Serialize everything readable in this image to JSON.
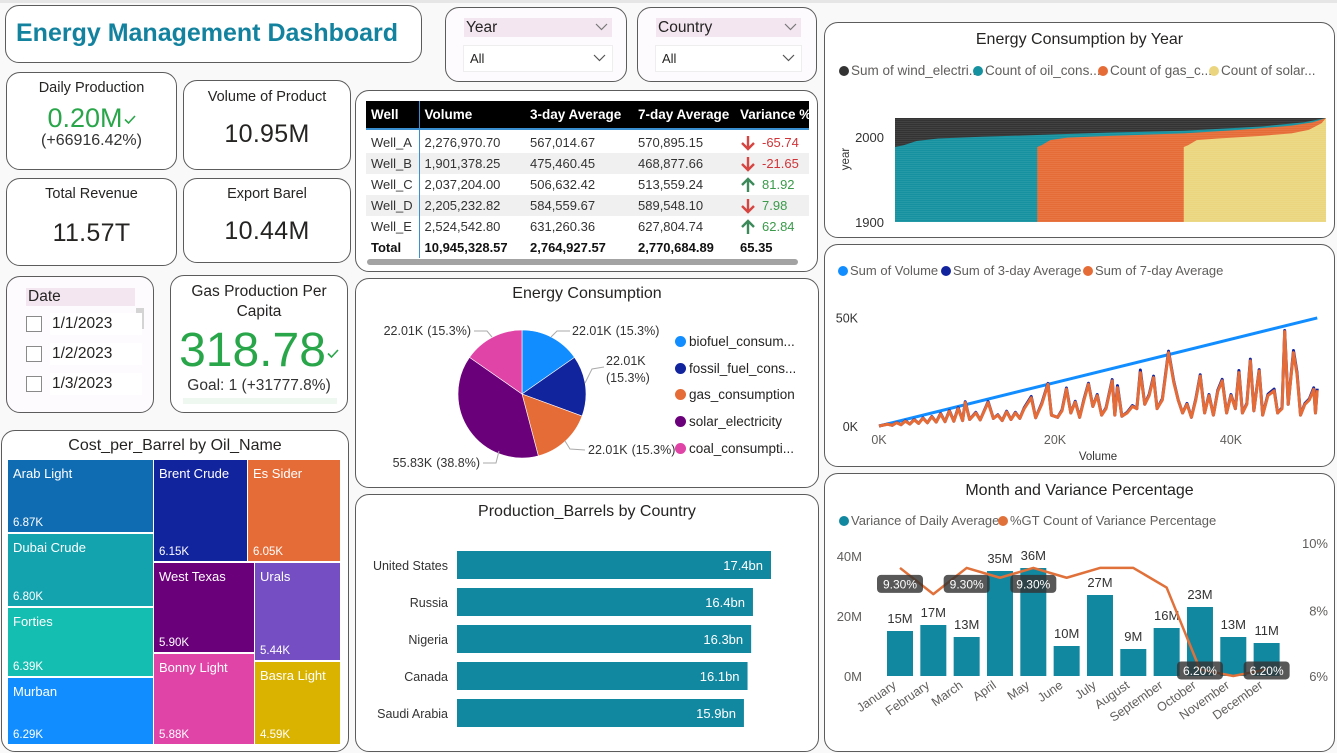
{
  "header": {
    "title": "Energy Management Dashboard"
  },
  "slicers": {
    "year": {
      "label": "Year",
      "value": "All"
    },
    "country": {
      "label": "Country",
      "value": "All"
    },
    "date": {
      "label": "Date",
      "options": [
        "1/1/2023",
        "1/2/2023",
        "1/3/2023"
      ]
    }
  },
  "cards": {
    "daily_production": {
      "title": "Daily Production",
      "value": "0.20M",
      "delta": "(+66916.42%)",
      "status": "good"
    },
    "volume_of_product": {
      "title": "Volume of Product",
      "value": "10.95M"
    },
    "total_revenue": {
      "title": "Total Revenue",
      "value": "11.57T"
    },
    "export_barel": {
      "title": "Export Barel",
      "value": "10.44M"
    },
    "gas_per_capita": {
      "title_line1": "Gas Production Per",
      "title_line2": "Capita",
      "value": "318.78",
      "goal": "Goal: 1 (+31777.8%)",
      "status": "good"
    }
  },
  "table": {
    "columns": [
      "Well",
      "Volume",
      "3-day Average",
      "7-day Average",
      "Variance %"
    ],
    "rows": [
      {
        "well": "Well_A",
        "volume": "2,276,970.70",
        "avg3": "567,014.67",
        "avg7": "570,895.15",
        "trend": "down",
        "variance": "-65.74",
        "variance_color": "#D13438"
      },
      {
        "well": "Well_B",
        "volume": "1,901,378.25",
        "avg3": "475,460.45",
        "avg7": "468,877.66",
        "trend": "down",
        "variance": "-21.65",
        "variance_color": "#D13438"
      },
      {
        "well": "Well_C",
        "volume": "2,037,204.00",
        "avg3": "506,632.42",
        "avg7": "513,559.24",
        "trend": "up",
        "variance": "81.92",
        "variance_color": "#3A9A4A"
      },
      {
        "well": "Well_D",
        "volume": "2,205,232.82",
        "avg3": "584,559.67",
        "avg7": "589,548.10",
        "trend": "down",
        "variance": "7.98",
        "variance_color": "#3A9A4A"
      },
      {
        "well": "Well_E",
        "volume": "2,524,542.80",
        "avg3": "631,260.36",
        "avg7": "627,804.74",
        "trend": "up",
        "variance": "62.84",
        "variance_color": "#3A9A4A"
      }
    ],
    "total": {
      "well": "Total",
      "volume": "10,945,328.57",
      "avg3": "2,764,927.57",
      "avg7": "2,770,684.89",
      "variance": "65.35"
    }
  },
  "colors": {
    "title": "#13829F",
    "good": "#2AA64A",
    "arrow_down": "#D64541",
    "arrow_up": "#3C8A5A",
    "accent_line": "#3A8FD0"
  },
  "chart_data": [
    {
      "type": "treemap",
      "title": "Cost_per_Barrel by Oil_Name",
      "items": [
        {
          "name": "Arab Light",
          "value": 6.87,
          "label": "6.87K",
          "color": "#0F6CB3"
        },
        {
          "name": "Dubai Crude",
          "value": 6.8,
          "label": "6.80K",
          "color": "#12A3AF"
        },
        {
          "name": "Forties",
          "value": 6.39,
          "label": "6.39K",
          "color": "#14BEB0"
        },
        {
          "name": "Murban",
          "value": 6.29,
          "label": "6.29K",
          "color": "#118DFF"
        },
        {
          "name": "Brent Crude",
          "value": 6.15,
          "label": "6.15K",
          "color": "#12239E"
        },
        {
          "name": "Es Sider",
          "value": 6.05,
          "label": "6.05K",
          "color": "#E66C37"
        },
        {
          "name": "West Texas",
          "value": 5.9,
          "label": "5.90K",
          "color": "#6B007B"
        },
        {
          "name": "Urals",
          "value": 5.44,
          "label": "5.44K",
          "color": "#744EC2"
        },
        {
          "name": "Bonny Light",
          "value": 5.88,
          "label": "5.88K",
          "color": "#E044A7"
        },
        {
          "name": "Basra Light",
          "value": 4.59,
          "label": "4.59K",
          "color": "#D9B300"
        }
      ]
    },
    {
      "type": "pie",
      "title": "Energy Consumption",
      "slices": [
        {
          "name": "biofuel_consum...",
          "value": 22.01,
          "value_label": "22.01K",
          "pct_label": "(15.3%)",
          "color": "#118DFF"
        },
        {
          "name": "fossil_fuel_cons...",
          "value": 22.01,
          "value_label": "22.01K",
          "pct_label": "(15.3%)",
          "color": "#12239E"
        },
        {
          "name": "gas_consumption",
          "value": 22.01,
          "value_label": "22.01K",
          "pct_label": "(15.3%)",
          "color": "#E66C37"
        },
        {
          "name": "solar_electricity",
          "value": 55.83,
          "value_label": "55.83K",
          "pct_label": "(38.8%)",
          "color": "#6B007B"
        },
        {
          "name": "coal_consumpti...",
          "value": 22.01,
          "value_label": "22.01K",
          "pct_label": "(15.3%)",
          "color": "#E044A7"
        }
      ]
    },
    {
      "type": "bar",
      "orientation": "horizontal",
      "title": "Production_Barrels by Country",
      "categories": [
        "United States",
        "Russia",
        "Nigeria",
        "Canada",
        "Saudi Arabia"
      ],
      "values": [
        17.4,
        16.4,
        16.3,
        16.1,
        15.9
      ],
      "labels": [
        "17.4bn",
        "16.4bn",
        "16.3bn",
        "16.1bn",
        "15.9bn"
      ],
      "unit": "bn",
      "color": "#1287A0",
      "xlim": [
        0,
        17.4
      ]
    },
    {
      "type": "area",
      "title": "Energy Consumption by Year",
      "ylabel": "year",
      "yticks": [
        2000,
        1900
      ],
      "ylim": [
        1900,
        2022
      ],
      "xlim": [
        0,
        100
      ],
      "legend": [
        {
          "name": "Sum of wind_electri...",
          "color": "#333333"
        },
        {
          "name": "Count of oil_cons...",
          "color": "#15919F"
        },
        {
          "name": "Count of gas_c...",
          "color": "#E66C37"
        },
        {
          "name": "Count of solar...",
          "color": "#EBD67F"
        }
      ],
      "layers": [
        {
          "series": "wind",
          "color": "#333333",
          "top": [
            [
              0,
              2022
            ],
            [
              100,
              2022
            ]
          ]
        },
        {
          "series": "oil",
          "color": "#15919F",
          "top": [
            [
              0,
              1988
            ],
            [
              2,
              1990
            ],
            [
              5,
              1995
            ],
            [
              10,
              1998
            ],
            [
              20,
              2000
            ],
            [
              33,
              2002
            ],
            [
              50,
              2005
            ],
            [
              67,
              2007
            ],
            [
              85,
              2012
            ],
            [
              95,
              2017
            ],
            [
              100,
              2022
            ]
          ]
        },
        {
          "series": "gas",
          "color": "#E66C37",
          "top": [
            [
              33,
              1988
            ],
            [
              34,
              1990
            ],
            [
              36,
              1996
            ],
            [
              40,
              1999
            ],
            [
              50,
              2001
            ],
            [
              67,
              2004
            ],
            [
              80,
              2008
            ],
            [
              92,
              2013
            ],
            [
              97,
              2017
            ],
            [
              100,
              2022
            ]
          ]
        },
        {
          "series": "solar",
          "color": "#EBD67F",
          "top": [
            [
              67,
              1988
            ],
            [
              68,
              1990
            ],
            [
              70,
              1996
            ],
            [
              75,
              1998
            ],
            [
              85,
              2001
            ],
            [
              92,
              2004
            ],
            [
              96,
              2008
            ],
            [
              99,
              2016
            ],
            [
              100,
              2022
            ]
          ]
        }
      ]
    },
    {
      "type": "line",
      "title": "",
      "xlabel": "Volume",
      "xticks": [
        {
          "value": 0,
          "label": "0K"
        },
        {
          "value": 20,
          "label": "20K"
        },
        {
          "value": 40,
          "label": "40K"
        }
      ],
      "yticks": [
        {
          "value": 50,
          "label": "50K"
        },
        {
          "value": 0,
          "label": "0K"
        }
      ],
      "xlim": [
        0,
        50
      ],
      "ylim": [
        0,
        50
      ],
      "units": "K",
      "legend": [
        {
          "name": "Sum of Volume",
          "color": "#118DFF"
        },
        {
          "name": "Sum of 3-day Average",
          "color": "#12239E"
        },
        {
          "name": "Sum of 7-day Average",
          "color": "#E66C37"
        }
      ],
      "volume_series": [
        [
          0,
          0
        ],
        [
          49.8,
          49.8
        ]
      ],
      "avg_points_x_y3_y7": [
        [
          0,
          0,
          0
        ],
        [
          1,
          0.9,
          0.8
        ],
        [
          1.5,
          0.3,
          0.3
        ],
        [
          2,
          1.6,
          1.5
        ],
        [
          2.5,
          0.6,
          0.6
        ],
        [
          3,
          2.4,
          2.2
        ],
        [
          3.5,
          0.9,
          0.9
        ],
        [
          4,
          3.0,
          2.8
        ],
        [
          4.5,
          1.2,
          1.2
        ],
        [
          5,
          3.7,
          3.5
        ],
        [
          5.5,
          1.5,
          1.5
        ],
        [
          6,
          4.4,
          4.2
        ],
        [
          6.5,
          1.8,
          1.8
        ],
        [
          7,
          5.8,
          5.5
        ],
        [
          7.5,
          2.0,
          2.0
        ],
        [
          8,
          7.1,
          6.8
        ],
        [
          8.5,
          2.2,
          2.2
        ],
        [
          9,
          8.4,
          8.0
        ],
        [
          9.5,
          2.5,
          2.5
        ],
        [
          9.8,
          11.2,
          10.8
        ],
        [
          10.3,
          3.0,
          3.0
        ],
        [
          11,
          6.3,
          6.0
        ],
        [
          11.5,
          2.8,
          2.8
        ],
        [
          12.4,
          11.2,
          10.8
        ],
        [
          13,
          3.5,
          3.5
        ],
        [
          13.5,
          5.2,
          5.0
        ],
        [
          14,
          2.5,
          2.5
        ],
        [
          14.5,
          6.8,
          6.5
        ],
        [
          15,
          3.0,
          3.0
        ],
        [
          15.5,
          6.3,
          6.0
        ],
        [
          16,
          3.5,
          3.5
        ],
        [
          16.5,
          8.4,
          8.0
        ],
        [
          17.3,
          13.6,
          13.0
        ],
        [
          17.8,
          3.8,
          3.8
        ],
        [
          18.5,
          10.5,
          10.0
        ],
        [
          19.2,
          19.6,
          19.2
        ],
        [
          19.6,
          5.0,
          5.0
        ],
        [
          20.3,
          4.0,
          4.0
        ],
        [
          20.8,
          7.4,
          7.0
        ],
        [
          21.3,
          17.5,
          17.0
        ],
        [
          21.8,
          6.0,
          6.0
        ],
        [
          22.3,
          11.4,
          11.0
        ],
        [
          22.8,
          4.0,
          4.0
        ],
        [
          23.3,
          12.5,
          12.0
        ],
        [
          23.8,
          19.7,
          19.2
        ],
        [
          24.3,
          9.0,
          9.0
        ],
        [
          24.8,
          14.5,
          14.0
        ],
        [
          25.3,
          5.0,
          5.0
        ],
        [
          25.8,
          8.4,
          8.0
        ],
        [
          26.5,
          21.4,
          20.8
        ],
        [
          26.8,
          5.0,
          5.0
        ],
        [
          27.1,
          18.6,
          17.7
        ],
        [
          27.6,
          4.5,
          4.5
        ],
        [
          28.2,
          6.3,
          6.0
        ],
        [
          28.8,
          9.4,
          9.0
        ],
        [
          29.3,
          8.0,
          8.0
        ],
        [
          29.7,
          25.8,
          24.6
        ],
        [
          30.2,
          10.0,
          10.0
        ],
        [
          30.7,
          14.5,
          14.0
        ],
        [
          31.2,
          23.0,
          22.3
        ],
        [
          31.6,
          8.0,
          8.0
        ],
        [
          32.2,
          12.5,
          12.0
        ],
        [
          32.9,
          34.5,
          33.8
        ],
        [
          33.5,
          20.5,
          20.0
        ],
        [
          34.0,
          12.0,
          12.0
        ],
        [
          34.5,
          6.0,
          6.0
        ],
        [
          35.0,
          10.4,
          10.0
        ],
        [
          35.5,
          4.0,
          4.0
        ],
        [
          36.0,
          12.5,
          12.0
        ],
        [
          36.5,
          23.6,
          23.0
        ],
        [
          37.0,
          6.0,
          6.0
        ],
        [
          37.5,
          14.5,
          14.0
        ],
        [
          38.0,
          5.0,
          5.0
        ],
        [
          38.5,
          16.5,
          16.0
        ],
        [
          39.0,
          21.5,
          20.8
        ],
        [
          39.5,
          6.0,
          6.0
        ],
        [
          40.0,
          14.5,
          14.0
        ],
        [
          40.5,
          8.0,
          8.0
        ],
        [
          40.9,
          25.6,
          24.6
        ],
        [
          41.3,
          6.0,
          6.0
        ],
        [
          41.8,
          10.4,
          10.0
        ],
        [
          42.2,
          30.8,
          30.0
        ],
        [
          42.6,
          7.0,
          7.0
        ],
        [
          43.2,
          26.0,
          25.4
        ],
        [
          43.6,
          5.0,
          5.0
        ],
        [
          44.2,
          14.6,
          14.0
        ],
        [
          44.9,
          17.0,
          16.2
        ],
        [
          45.3,
          6.0,
          6.0
        ],
        [
          45.8,
          8.4,
          8.0
        ],
        [
          46.1,
          44.0,
          43.5
        ],
        [
          46.5,
          10.0,
          10.0
        ],
        [
          47.1,
          34.8,
          33.8
        ],
        [
          47.5,
          24.8,
          23.8
        ],
        [
          47.9,
          5.0,
          5.0
        ],
        [
          48.4,
          10.4,
          10.0
        ],
        [
          48.9,
          12.5,
          12.0
        ],
        [
          49.4,
          17.6,
          16.9
        ],
        [
          49.6,
          6.0,
          6.0
        ],
        [
          49.8,
          17.2,
          16.5
        ]
      ]
    },
    {
      "type": "bar+line",
      "title": "Month and Variance Percentage",
      "categories": [
        "January",
        "February",
        "March",
        "April",
        "May",
        "June",
        "July",
        "August",
        "September",
        "October",
        "November",
        "December"
      ],
      "bars": {
        "name": "Variance of Daily Average",
        "values": [
          15,
          17,
          13,
          35,
          36,
          10,
          27,
          9,
          16,
          23,
          13,
          11
        ],
        "labels": [
          "15M",
          "17M",
          "13M",
          "35M",
          "36M",
          "10M",
          "27M",
          "9M",
          "16M",
          "23M",
          "13M",
          "11M"
        ],
        "color": "#1287A0"
      },
      "line": {
        "name": "%GT Count of Variance Percentage",
        "values": [
          9.3,
          8.5,
          9.3,
          9.0,
          9.3,
          9.0,
          9.3,
          9.3,
          8.7,
          6.2,
          6.0,
          6.2
        ],
        "color": "#E0713A",
        "point_labels": [
          {
            "index": 0,
            "text": "9.30%"
          },
          {
            "index": 2,
            "text": "9.30%"
          },
          {
            "index": 4,
            "text": "9.30%"
          },
          {
            "index": 9,
            "text": "6.20%"
          },
          {
            "index": 11,
            "text": "6.20%"
          }
        ]
      },
      "y_left": {
        "ticks": [
          {
            "value": 40,
            "label": "40M"
          },
          {
            "value": 20,
            "label": "20M"
          },
          {
            "value": 0,
            "label": "0M"
          }
        ],
        "ylim": [
          0,
          40
        ]
      },
      "y_right": {
        "ticks": [
          {
            "value": 10,
            "label": "10%"
          },
          {
            "value": 8,
            "label": "8%"
          },
          {
            "value": 6,
            "label": "6%"
          }
        ],
        "ylim": [
          6,
          10
        ]
      }
    }
  ]
}
